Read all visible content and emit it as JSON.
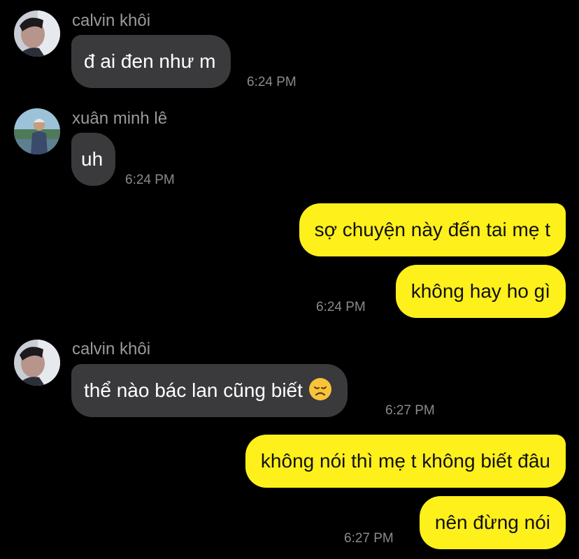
{
  "colors": {
    "background": "#000000",
    "incoming_bubble": "#3a3a3c",
    "outgoing_bubble": "#fef01b",
    "sender_text": "#9a9a9a",
    "timestamp_text": "#8a8a8a"
  },
  "messages": [
    {
      "sender": "calvin khôi",
      "direction": "incoming",
      "text": "đ ai đen như m",
      "time": "6:24 PM"
    },
    {
      "sender": "xuân minh lê",
      "direction": "incoming",
      "text": "uh",
      "time": "6:24 PM"
    },
    {
      "direction": "outgoing",
      "text": "sợ chuyện này đến tai mẹ t"
    },
    {
      "direction": "outgoing",
      "text": "không hay ho gì",
      "time": "6:24 PM"
    },
    {
      "sender": "calvin khôi",
      "direction": "incoming",
      "text": "thể nào bác lan cũng biết",
      "emoji": "disappointed-face-icon",
      "time": "6:27 PM"
    },
    {
      "direction": "outgoing",
      "text": "không nói thì mẹ t không biết đâu"
    },
    {
      "direction": "outgoing",
      "text": "nên đừng nói",
      "time": "6:27 PM"
    }
  ]
}
